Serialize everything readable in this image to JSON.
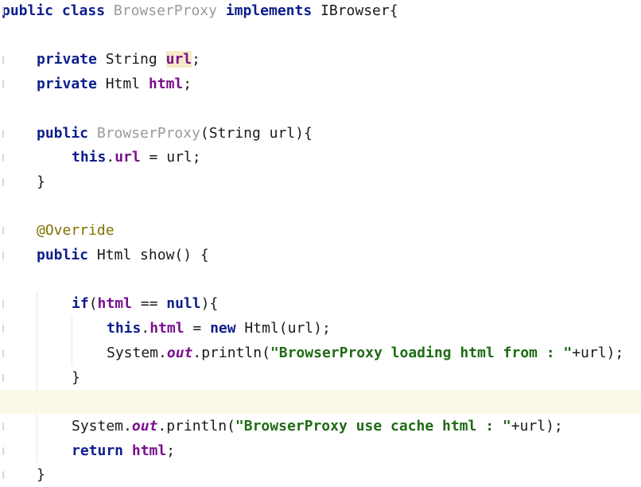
{
  "editor": {
    "current_line_index": 16,
    "caret": {
      "line": 16,
      "after_token": 5
    },
    "lines": [
      {
        "indent": 0,
        "tokens": [
          {
            "t": "public",
            "k": "kw"
          },
          {
            "t": " ",
            "k": "plain"
          },
          {
            "t": "class",
            "k": "kw"
          },
          {
            "t": " ",
            "k": "plain"
          },
          {
            "t": "BrowserProxy",
            "k": "gray"
          },
          {
            "t": " ",
            "k": "plain"
          },
          {
            "t": "implements",
            "k": "kw"
          },
          {
            "t": " ",
            "k": "plain"
          },
          {
            "t": "IBrowser{",
            "k": "plain"
          }
        ]
      },
      {
        "indent": 0,
        "tokens": []
      },
      {
        "indent": 1,
        "tokens": [
          {
            "t": "private",
            "k": "kw"
          },
          {
            "t": " String ",
            "k": "plain"
          },
          {
            "t": "url",
            "k": "hl"
          },
          {
            "t": ";",
            "k": "plain"
          }
        ]
      },
      {
        "indent": 1,
        "tokens": [
          {
            "t": "private",
            "k": "kw"
          },
          {
            "t": " Html ",
            "k": "plain"
          },
          {
            "t": "html",
            "k": "field"
          },
          {
            "t": ";",
            "k": "plain"
          }
        ]
      },
      {
        "indent": 0,
        "tokens": []
      },
      {
        "indent": 1,
        "tokens": [
          {
            "t": "public",
            "k": "kw"
          },
          {
            "t": " ",
            "k": "plain"
          },
          {
            "t": "BrowserProxy",
            "k": "gray"
          },
          {
            "t": "(String url){",
            "k": "plain"
          }
        ]
      },
      {
        "indent": 2,
        "tokens": [
          {
            "t": "this",
            "k": "kw"
          },
          {
            "t": ".",
            "k": "plain"
          },
          {
            "t": "url",
            "k": "field"
          },
          {
            "t": " = url;",
            "k": "plain"
          }
        ]
      },
      {
        "indent": 1,
        "tokens": [
          {
            "t": "}",
            "k": "plain"
          }
        ]
      },
      {
        "indent": 0,
        "tokens": []
      },
      {
        "indent": 1,
        "tokens": [
          {
            "t": "@Override",
            "k": "ann"
          }
        ]
      },
      {
        "indent": 1,
        "tokens": [
          {
            "t": "public",
            "k": "kw"
          },
          {
            "t": " Html show() {",
            "k": "plain"
          }
        ]
      },
      {
        "indent": 0,
        "tokens": []
      },
      {
        "indent": 2,
        "tokens": [
          {
            "t": "if",
            "k": "kw"
          },
          {
            "t": "(",
            "k": "plain"
          },
          {
            "t": "html",
            "k": "field"
          },
          {
            "t": " == ",
            "k": "plain"
          },
          {
            "t": "null",
            "k": "kw"
          },
          {
            "t": "){",
            "k": "plain"
          }
        ]
      },
      {
        "indent": 3,
        "tokens": [
          {
            "t": "this",
            "k": "kw"
          },
          {
            "t": ".",
            "k": "plain"
          },
          {
            "t": "html",
            "k": "field"
          },
          {
            "t": " = ",
            "k": "plain"
          },
          {
            "t": "new",
            "k": "kw"
          },
          {
            "t": " Html(url);",
            "k": "plain"
          }
        ]
      },
      {
        "indent": 3,
        "tokens": [
          {
            "t": "System.",
            "k": "plain"
          },
          {
            "t": "out",
            "k": "static"
          },
          {
            "t": ".println(",
            "k": "plain"
          },
          {
            "t": "\"BrowserProxy loading html from : \"",
            "k": "str"
          },
          {
            "t": "+url);",
            "k": "plain"
          }
        ]
      },
      {
        "indent": 2,
        "tokens": [
          {
            "t": "}",
            "k": "plain"
          }
        ]
      },
      {
        "indent": 0,
        "tokens": []
      },
      {
        "indent": 2,
        "tokens": [
          {
            "t": "System.",
            "k": "plain"
          },
          {
            "t": "out",
            "k": "static"
          },
          {
            "t": ".println(",
            "k": "plain"
          },
          {
            "t": "\"BrowserProxy use cache html",
            "k": "str"
          },
          {
            "t": " : \"",
            "k": "str"
          },
          {
            "t": "+url);",
            "k": "plain"
          }
        ]
      },
      {
        "indent": 2,
        "tokens": [
          {
            "t": "return",
            "k": "kw"
          },
          {
            "t": " ",
            "k": "plain"
          },
          {
            "t": "html",
            "k": "field"
          },
          {
            "t": ";",
            "k": "plain"
          }
        ]
      },
      {
        "indent": 1,
        "tokens": [
          {
            "t": "}",
            "k": "plain"
          }
        ]
      }
    ]
  }
}
